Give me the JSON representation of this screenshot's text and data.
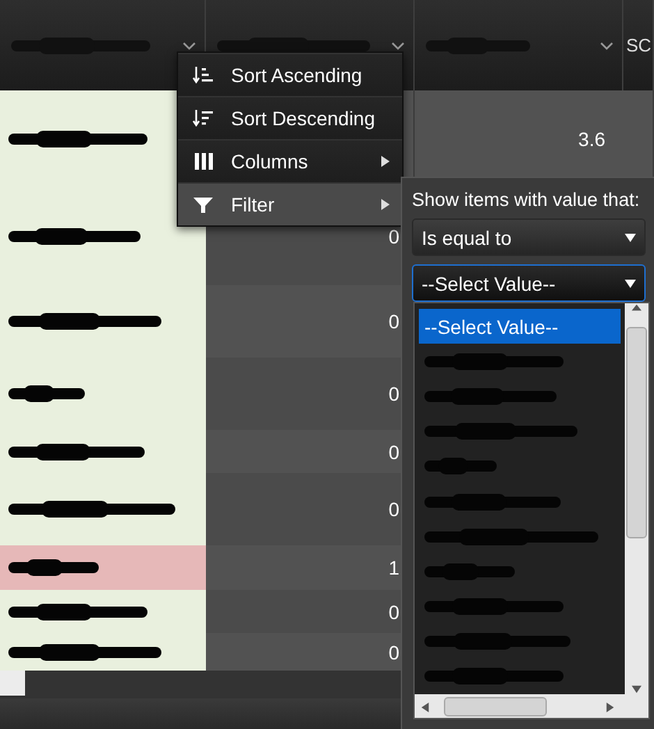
{
  "grid": {
    "columns": [
      {
        "kind": "redacted"
      },
      {
        "kind": "redacted"
      },
      {
        "kind": "redacted"
      },
      {
        "kind": "text",
        "label": "SC"
      }
    ],
    "rows": [
      {
        "kind": "redacted",
        "highlighted": false,
        "value_3": "3.6"
      },
      {
        "kind": "redacted",
        "highlighted": false,
        "value_2": "0"
      },
      {
        "kind": "redacted",
        "highlighted": false,
        "value_2": "0"
      },
      {
        "kind": "redacted",
        "highlighted": false,
        "value_2": "0"
      },
      {
        "kind": "redacted",
        "highlighted": false,
        "value_2": "0"
      },
      {
        "kind": "redacted",
        "highlighted": false,
        "value_2": "0"
      },
      {
        "kind": "redacted",
        "highlighted": true,
        "value_2": "1"
      },
      {
        "kind": "redacted",
        "highlighted": false,
        "value_2": "0"
      },
      {
        "kind": "redacted",
        "highlighted": false,
        "value_2": "0"
      }
    ]
  },
  "column_menu": {
    "items": [
      {
        "kind": "sort_ascending",
        "label": "Sort Ascending",
        "active": false
      },
      {
        "kind": "sort_descending",
        "label": "Sort Descending",
        "active": false
      },
      {
        "kind": "columns",
        "label": "Columns",
        "active": false
      },
      {
        "kind": "filter",
        "label": "Filter",
        "active": true
      }
    ]
  },
  "filter_panel": {
    "prompt": "Show items with value that:",
    "operator": "Is equal to",
    "value": "--Select Value--",
    "options": [
      {
        "kind": "text",
        "label": "--Select Value--",
        "selected": true
      },
      {
        "kind": "redacted",
        "selected": false
      },
      {
        "kind": "redacted",
        "selected": false
      },
      {
        "kind": "redacted",
        "selected": false
      },
      {
        "kind": "redacted",
        "selected": false
      },
      {
        "kind": "redacted",
        "selected": false
      },
      {
        "kind": "redacted",
        "selected": false
      },
      {
        "kind": "redacted",
        "selected": false
      },
      {
        "kind": "redacted",
        "selected": false
      },
      {
        "kind": "redacted",
        "selected": false
      },
      {
        "kind": "redacted",
        "selected": false
      }
    ]
  }
}
